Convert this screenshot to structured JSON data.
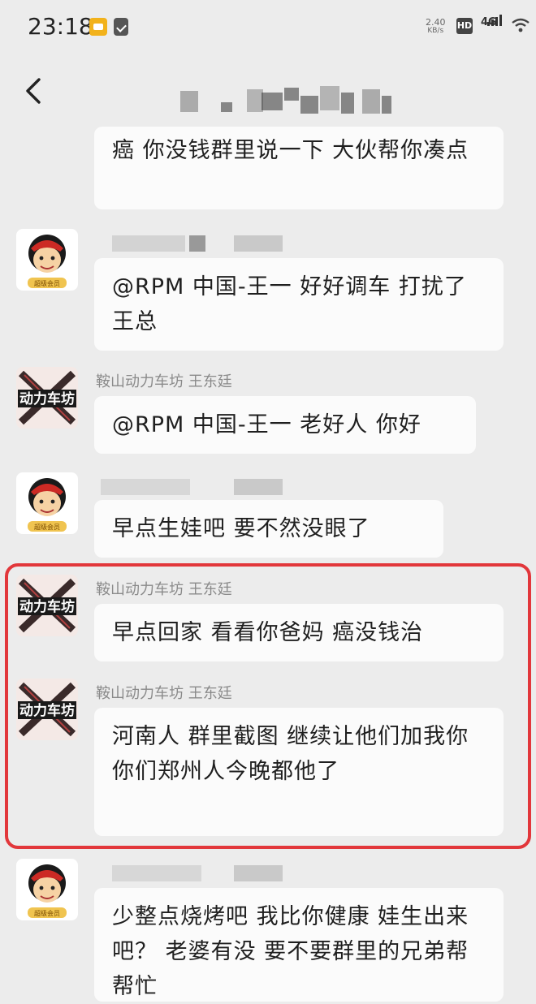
{
  "status_bar": {
    "time": "23:18",
    "net_speed_value": "2.40",
    "net_speed_unit": "KB/s",
    "hd_label": "HD",
    "network_label": "4G"
  },
  "header": {
    "back_icon": "chevron-left-icon",
    "title_obscured": true
  },
  "messages": [
    {
      "sender": "",
      "sender_obscured": false,
      "avatar": "none",
      "text": "癌 你没钱群里说一下 大伙帮你凑点"
    },
    {
      "sender": "",
      "sender_obscured": true,
      "avatar": "caishen-avatar",
      "text": "@RPM 中国-王一  好好调车 打扰了王总"
    },
    {
      "sender": "鞍山动力车坊 王东廷",
      "avatar": "dongli-chefang-logo",
      "text": "@RPM 中国-王一  老好人 你好"
    },
    {
      "sender": "",
      "sender_obscured": true,
      "avatar": "caishen-avatar",
      "text": "早点生娃吧 要不然没眼了"
    },
    {
      "sender": "鞍山动力车坊 王东廷",
      "avatar": "dongli-chefang-logo",
      "text": "早点回家 看看你爸妈 癌没钱治"
    },
    {
      "sender": "鞍山动力车坊 王东廷",
      "avatar": "dongli-chefang-logo",
      "text": "河南人 群里截图 继续让他们加我你 你们郑州人今晚都他了"
    },
    {
      "sender": "",
      "sender_obscured": true,
      "avatar": "caishen-avatar",
      "text": "少整点烧烤吧 我比你健康 娃生出来吧？ 老婆有没 要不要群里的兄弟帮帮忙"
    }
  ],
  "avatar_badge_text": "超级会员",
  "logo_text": "动力车坊",
  "highlight_color": "#e2373b"
}
